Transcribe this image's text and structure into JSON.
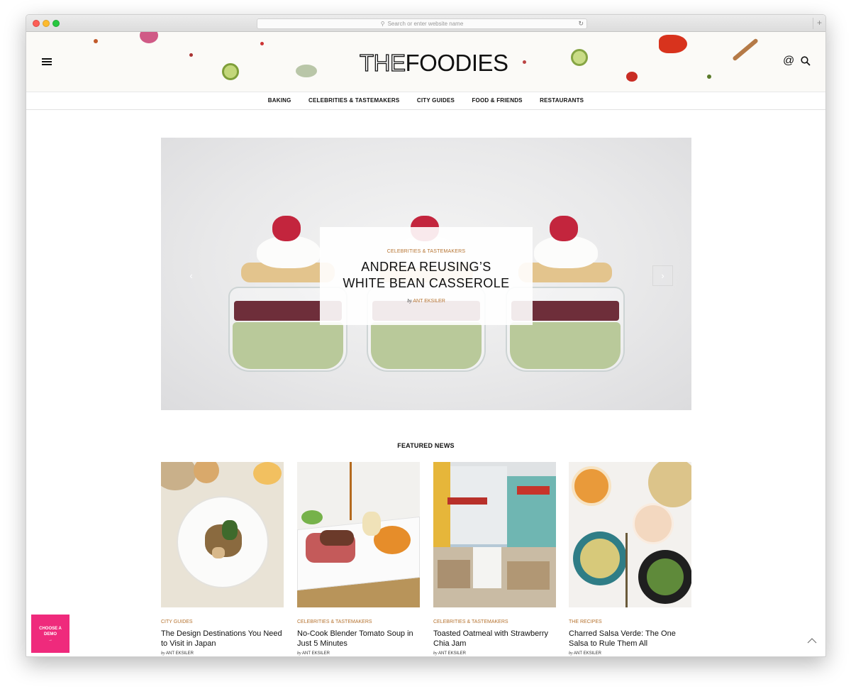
{
  "browser": {
    "url_placeholder": "Search or enter website name"
  },
  "header": {
    "logo_part1": "THE",
    "logo_part2": "FOODIES"
  },
  "nav": {
    "items": [
      "BAKING",
      "CELEBRITIES & TASTEMAKERS",
      "CITY GUIDES",
      "FOOD & FRIENDS",
      "RESTAURANTS"
    ]
  },
  "hero": {
    "category": "CELEBRITIES & TASTEMAKERS",
    "title_line1": "ANDREA REUSING’S",
    "title_line2": "WHITE BEAN CASSEROLE",
    "by_label": "by",
    "author": "ANT EKSILER",
    "prev_icon": "chevron-left-icon",
    "next_icon": "chevron-right-icon"
  },
  "featured": {
    "heading": "FEATURED NEWS",
    "cards": [
      {
        "category": "CITY GUIDES",
        "title": "The Design Destinations You Need to Visit in Japan",
        "by_label": "by",
        "author": "ANT EKSILER"
      },
      {
        "category": "CELEBRITIES & TASTEMAKERS",
        "title": "No-Cook Blender Tomato Soup in Just 5 Minutes",
        "by_label": "by",
        "author": "ANT EKSILER"
      },
      {
        "category": "CELEBRITIES & TASTEMAKERS",
        "title": "Toasted Oatmeal with Strawberry Chia Jam",
        "by_label": "by",
        "author": "ANT EKSILER"
      },
      {
        "category": "THE RECIPES",
        "title": "Charred Salsa Verde: The One Salsa to Rule Them All",
        "by_label": "by",
        "author": "ANT EKSILER"
      }
    ]
  },
  "demo_button": {
    "line1": "CHOOSE A",
    "line2": "DEMO",
    "arrow": "→"
  },
  "colors": {
    "accent": "#b5722f",
    "demo": "#ef2a7c"
  }
}
